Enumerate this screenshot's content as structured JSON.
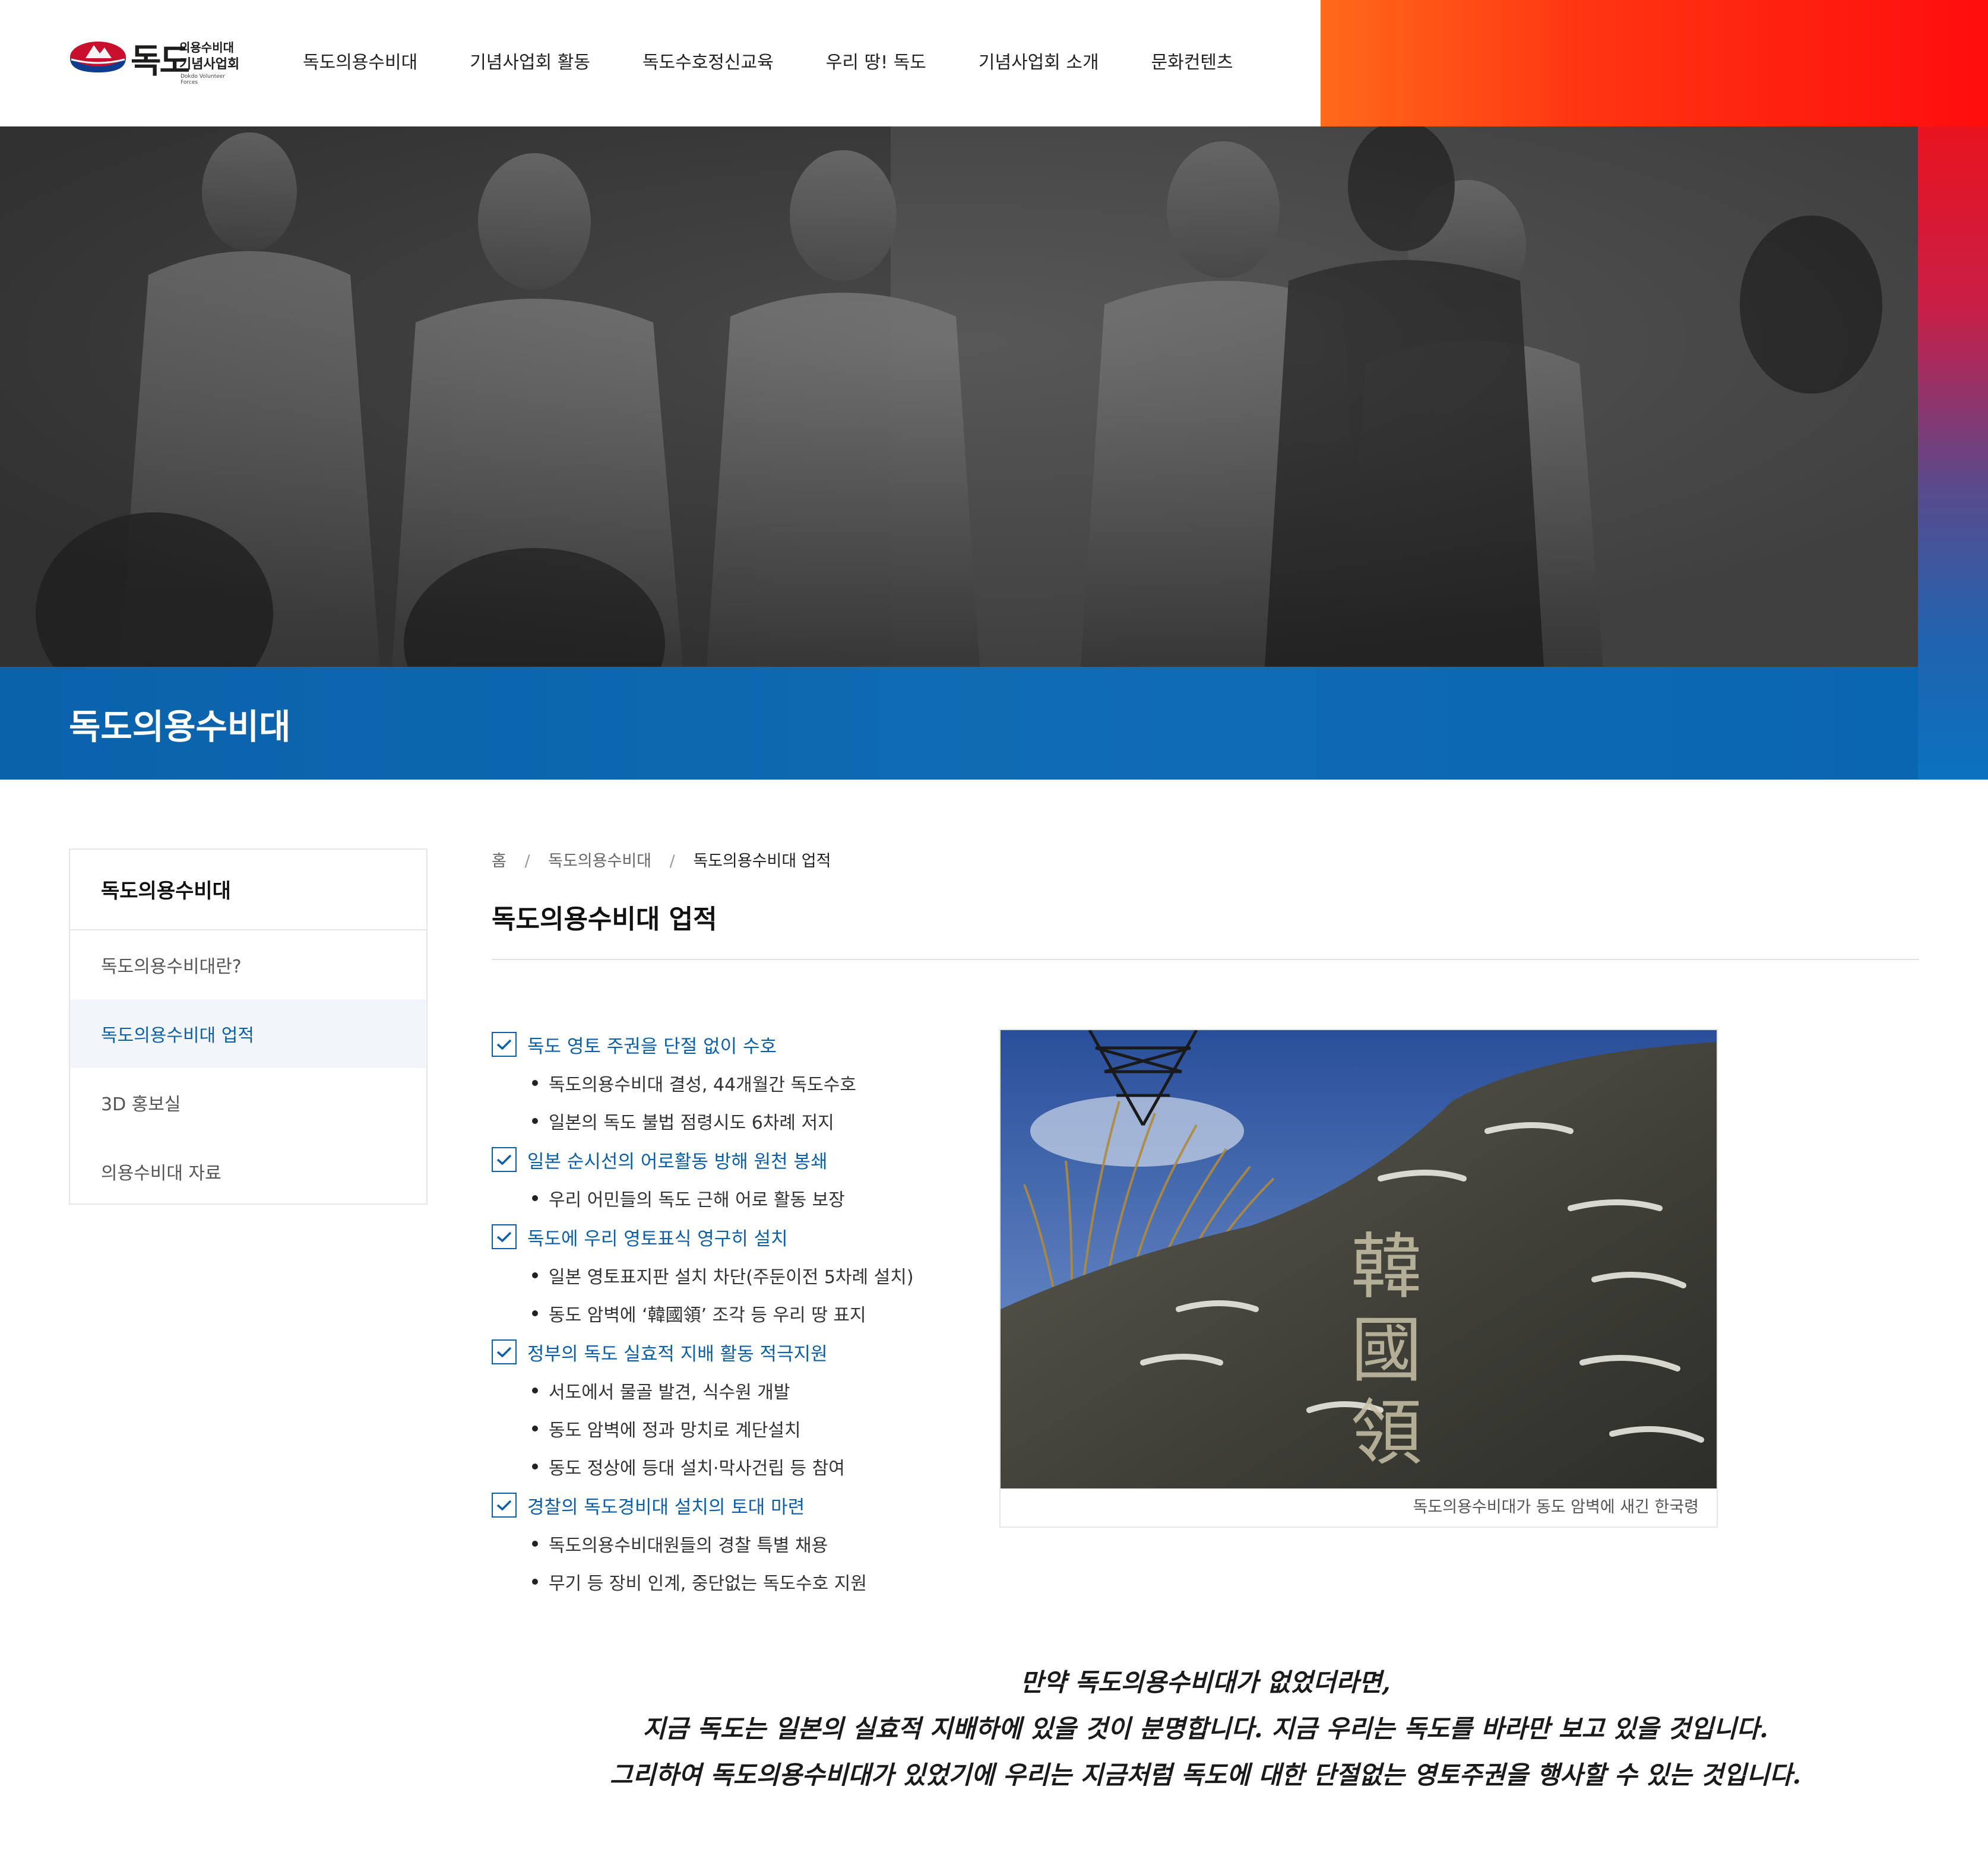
{
  "brand": {
    "logo_main": "독도",
    "logo_sub1": "의용수비대",
    "logo_sub2": "기념사업회",
    "logo_en": "Dokdo Volunteer Forces"
  },
  "nav": {
    "items": [
      {
        "label": "독도의용수비대"
      },
      {
        "label": "기념사업회 활동"
      },
      {
        "label": "독도수호정신교육"
      },
      {
        "label": "우리 땅! 독도"
      },
      {
        "label": "기념사업회 소개"
      },
      {
        "label": "문화컨텐츠"
      }
    ]
  },
  "hero": {
    "heading": "독도의용수비대"
  },
  "sidebar": {
    "title": "독도의용수비대",
    "items": [
      {
        "label": "독도의용수비대란?",
        "active": false
      },
      {
        "label": "독도의용수비대 업적",
        "active": true
      },
      {
        "label": "3D 홍보실",
        "active": false
      },
      {
        "label": "의용수비대 자료",
        "active": false
      }
    ]
  },
  "breadcrumb": {
    "home": "홈",
    "sep": "/",
    "level1": "독도의용수비대",
    "current": "독도의용수비대 업적"
  },
  "content": {
    "title": "독도의용수비대 업적",
    "achievements": [
      {
        "heading": "독도 영토 주권을 단절 없이 수호",
        "points": [
          "독도의용수비대 결성, 44개월간 독도수호",
          "일본의 독도 불법 점령시도 6차례 저지"
        ]
      },
      {
        "heading": "일본 순시선의 어로활동 방해 원천 봉쇄",
        "points": [
          "우리 어민들의 독도 근해 어로 활동 보장"
        ]
      },
      {
        "heading": "독도에 우리 영토표식 영구히 설치",
        "points": [
          "일본 영토표지판 설치 차단(주둔이전 5차례 설치)",
          "동도 암벽에 ‘韓國領’ 조각 등 우리 땅 표지"
        ]
      },
      {
        "heading": "정부의 독도 실효적 지배 활동 적극지원",
        "points": [
          "서도에서 물골 발견, 식수원 개발",
          "동도 암벽에 정과 망치로 계단설치",
          "동도 정상에 등대 설치·막사건립 등 참여"
        ]
      },
      {
        "heading": "경찰의 독도경비대 설치의 토대 마련",
        "points": [
          "독도의용수비대원들의 경찰 특별 채용",
          "무기 등 장비 인계, 중단없는 독도수호 지원"
        ]
      }
    ],
    "figure_caption": "독도의용수비대가 동도 암벽에 새긴 한국령",
    "figure_carving": [
      "韓",
      "國",
      "領"
    ]
  },
  "quote": {
    "line1": "만약 독도의용수비대가 없었더라면,",
    "line2": "지금 독도는 일본의 실효적 지배하에 있을 것이 분명합니다. 지금 우리는 독도를 바라만 보고 있을 것입니다.",
    "line3": "그리하여 독도의용수비대가 있었기에 우리는 지금처럼 독도에 대한 단절없는 영토주권을 행사할 수 있는 것입니다."
  },
  "colors": {
    "accent": "#0b5fa8",
    "band": "#0f6bb3",
    "header_gradient_start": "#ff6a1a",
    "header_gradient_end": "#ff0d0d"
  },
  "icons": {
    "check": "check-icon",
    "bullet": "bullet-dot"
  }
}
